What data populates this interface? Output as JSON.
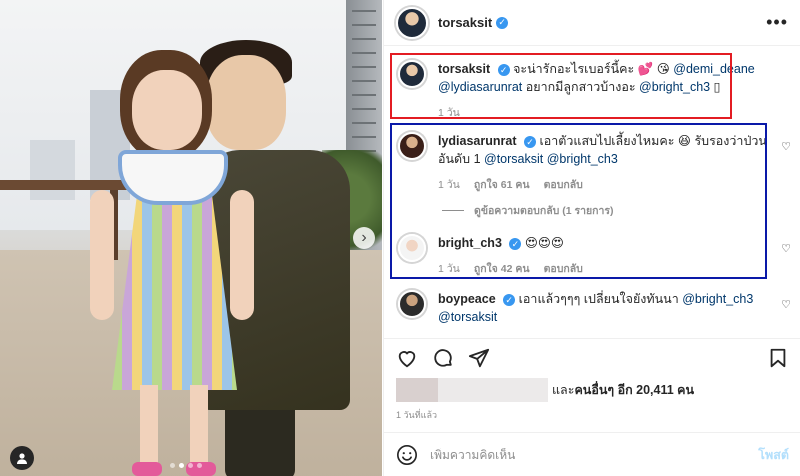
{
  "post": {
    "username": "torsaksit",
    "more_label": "•••"
  },
  "carousel": {
    "next_glyph": "›",
    "dot_count": 4,
    "active_dot": 1
  },
  "comments": [
    {
      "username": "torsaksit",
      "parts": [
        {
          "t": "จะน่ารักอะไรเบอร์นี้คะ 💕 😘 ",
          "m": false
        },
        {
          "t": "@demi_deane",
          "m": true
        },
        {
          "t": " ",
          "m": false
        },
        {
          "t": "@lydiasarunrat",
          "m": true
        },
        {
          "t": " อยากมีลูกสาวบ้างอะ ",
          "m": false
        },
        {
          "t": "@bright_ch3",
          "m": true
        },
        {
          "t": " ▯",
          "m": false
        }
      ],
      "time": "1 วัน",
      "likes": "",
      "reply": ""
    },
    {
      "username": "lydiasarunrat",
      "parts": [
        {
          "t": "เอาตัวแสบไปเลี้ยงไหมคะ 😆 รับรองว่าป่วนอันดับ 1 ",
          "m": false
        },
        {
          "t": "@torsaksit",
          "m": true
        },
        {
          "t": " ",
          "m": false
        },
        {
          "t": "@bright_ch3",
          "m": true
        }
      ],
      "time": "1 วัน",
      "likes": "ถูกใจ 61 คน",
      "reply": "ตอบกลับ"
    },
    {
      "username": "bright_ch3",
      "parts": [
        {
          "t": "😍😍😍",
          "m": false
        }
      ],
      "time": "1 วัน",
      "likes": "ถูกใจ 42 คน",
      "reply": "ตอบกลับ"
    },
    {
      "username": "boypeace",
      "parts": [
        {
          "t": "เอาแล้วๆๆๆ เปลี่ยนใจยังทันนา ",
          "m": false
        },
        {
          "t": "@bright_ch3",
          "m": true
        },
        {
          "t": " ",
          "m": false
        },
        {
          "t": "@torsaksit",
          "m": true
        }
      ],
      "time": "",
      "likes": "",
      "reply": ""
    }
  ],
  "view_replies": "ดูข้อความตอบกลับ (1 รายการ)",
  "likes": {
    "prefix": "และ",
    "others": "คนอื่นๆ อีก 20,411 คน"
  },
  "timestamp": "1 วันที่แล้ว",
  "add_comment": {
    "placeholder": "เพิ่มความคิดเห็น",
    "post_label": "โพสต์"
  },
  "colors": {
    "verified": "#3897f0",
    "mention": "#00376b",
    "highlight_red": "#e31c23",
    "highlight_blue": "#0a19a8",
    "post_disabled": "#b2dffc"
  }
}
